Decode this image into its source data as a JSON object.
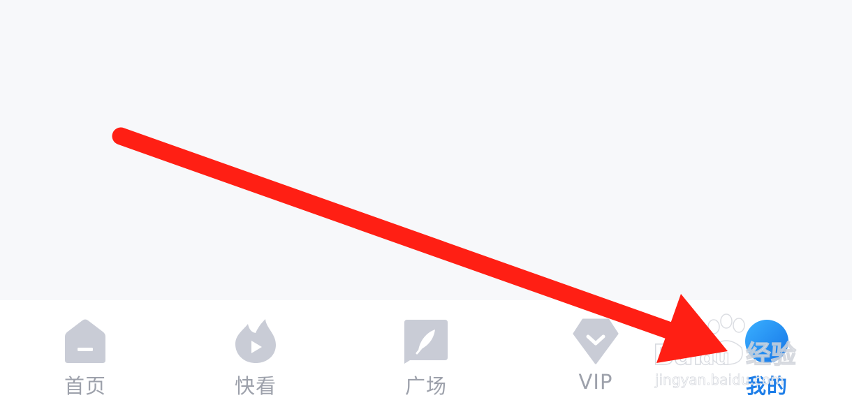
{
  "tabbar": {
    "items": [
      {
        "id": "home",
        "label": "首页",
        "icon": "home-icon"
      },
      {
        "id": "quick",
        "label": "快看",
        "icon": "flame-play-icon"
      },
      {
        "id": "square",
        "label": "广场",
        "icon": "feather-icon"
      },
      {
        "id": "vip",
        "label": "VIP",
        "icon": "vip-shield-icon"
      },
      {
        "id": "mine",
        "label": "我的",
        "icon": "profile-icon",
        "active": true
      }
    ]
  },
  "watermark": {
    "brand": "Bai",
    "brand_suffix": "du",
    "cn": "经验",
    "url": "jingyan.baidu.com"
  },
  "colors": {
    "background": "#f7f8fa",
    "tabbar": "#ffffff",
    "inactive": "#9da1ab",
    "active": "#1e7ee8",
    "icon_fill": "#c9ccd6",
    "arrow": "#ff1f14"
  }
}
